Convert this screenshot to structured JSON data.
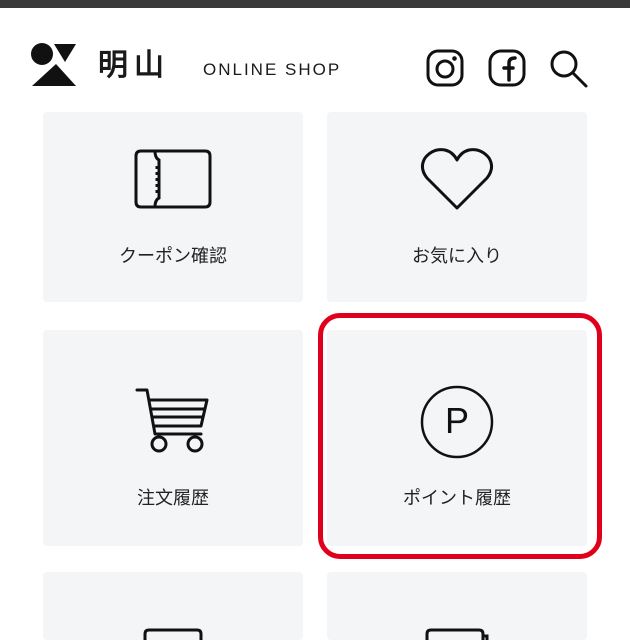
{
  "header": {
    "brand_kanji": "明山",
    "brand_shop": "ONLINE SHOP",
    "icons": [
      "instagram-icon",
      "facebook-icon",
      "search-icon"
    ]
  },
  "tiles": [
    {
      "label": "クーポン確認",
      "icon": "ticket-icon"
    },
    {
      "label": "お気に入り",
      "icon": "heart-icon"
    },
    {
      "label": "注文履歴",
      "icon": "cart-icon"
    },
    {
      "label": "ポイント履歴",
      "icon": "point-icon",
      "point_letter": "P",
      "highlighted": true
    }
  ],
  "colors": {
    "tile_bg": "#f4f5f6",
    "highlight": "#e0001b",
    "text": "#222222"
  }
}
